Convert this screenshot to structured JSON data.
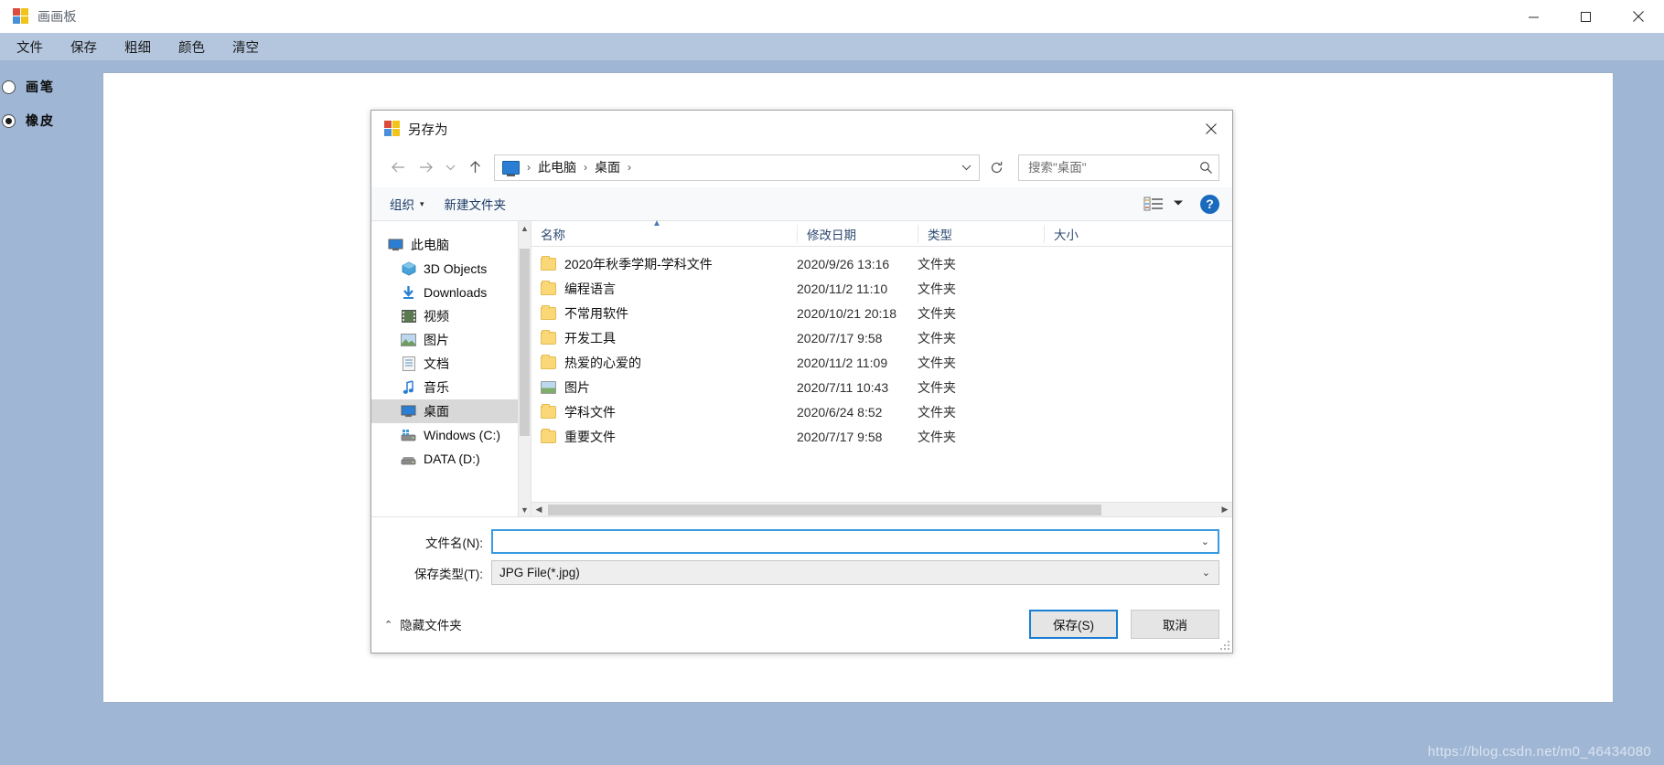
{
  "app": {
    "title": "画画板",
    "icon": "paint-app-icon",
    "window_controls": [
      {
        "name": "minimize",
        "glyph": "minimize-icon"
      },
      {
        "name": "maximize",
        "glyph": "maximize-icon"
      },
      {
        "name": "close",
        "glyph": "close-icon"
      }
    ],
    "menu": [
      {
        "label": "文件"
      },
      {
        "label": "保存"
      },
      {
        "label": "粗细"
      },
      {
        "label": "颜色"
      },
      {
        "label": "清空"
      }
    ],
    "tools": [
      {
        "label": "画笔",
        "selected": false
      },
      {
        "label": "橡皮",
        "selected": true
      }
    ],
    "watermark": "https://blog.csdn.net/m0_46434080"
  },
  "dialog": {
    "title": "另存为",
    "icon": "paint-app-icon",
    "close_label": "×",
    "nav": {
      "back": "back-arrow",
      "forward": "forward-arrow",
      "recent": "recent-chevron",
      "up": "up-arrow",
      "refresh": "refresh-icon"
    },
    "breadcrumb": {
      "root_icon": "this-pc-icon",
      "items": [
        "此电脑",
        "桌面"
      ],
      "separator": "›"
    },
    "search": {
      "placeholder": "搜索\"桌面\"",
      "value": "",
      "icon": "search-icon"
    },
    "toolbar": {
      "organize": "组织",
      "organize_caret": "▾",
      "new_folder": "新建文件夹",
      "view_icon": "view-list-icon",
      "view_caret": "▾",
      "help": "?"
    },
    "nav_pane": {
      "items": [
        {
          "label": "此电脑",
          "icon": "this-pc-icon",
          "level": 0,
          "selected": false
        },
        {
          "label": "3D Objects",
          "icon": "3d-objects-icon",
          "level": 1,
          "selected": false
        },
        {
          "label": "Downloads",
          "icon": "downloads-icon",
          "level": 1,
          "selected": false
        },
        {
          "label": "视频",
          "icon": "videos-icon",
          "level": 1,
          "selected": false
        },
        {
          "label": "图片",
          "icon": "pictures-icon",
          "level": 1,
          "selected": false
        },
        {
          "label": "文档",
          "icon": "documents-icon",
          "level": 1,
          "selected": false
        },
        {
          "label": "音乐",
          "icon": "music-icon",
          "level": 1,
          "selected": false
        },
        {
          "label": "桌面",
          "icon": "desktop-icon",
          "level": 1,
          "selected": true
        },
        {
          "label": "Windows (C:)",
          "icon": "windows-drive-icon",
          "level": 1,
          "selected": false
        },
        {
          "label": "DATA (D:)",
          "icon": "drive-icon",
          "level": 1,
          "selected": false
        }
      ]
    },
    "columns": [
      {
        "key": "name",
        "label": "名称"
      },
      {
        "key": "date",
        "label": "修改日期"
      },
      {
        "key": "type",
        "label": "类型"
      },
      {
        "key": "size",
        "label": "大小"
      }
    ],
    "sort_indicator": "▲",
    "files": [
      {
        "name": "2020年秋季学期-学科文件",
        "date": "2020/9/26 13:16",
        "type": "文件夹",
        "size": "",
        "icon": "folder-icon"
      },
      {
        "name": "编程语言",
        "date": "2020/11/2 11:10",
        "type": "文件夹",
        "size": "",
        "icon": "folder-icon"
      },
      {
        "name": "不常用软件",
        "date": "2020/10/21 20:18",
        "type": "文件夹",
        "size": "",
        "icon": "folder-icon"
      },
      {
        "name": "开发工具",
        "date": "2020/7/17 9:58",
        "type": "文件夹",
        "size": "",
        "icon": "folder-icon"
      },
      {
        "name": "热爱的心爱的",
        "date": "2020/11/2 11:09",
        "type": "文件夹",
        "size": "",
        "icon": "folder-icon"
      },
      {
        "name": "图片",
        "date": "2020/7/11 10:43",
        "type": "文件夹",
        "size": "",
        "icon": "picture-folder-icon"
      },
      {
        "name": "学科文件",
        "date": "2020/6/24 8:52",
        "type": "文件夹",
        "size": "",
        "icon": "folder-icon"
      },
      {
        "name": "重要文件",
        "date": "2020/7/17 9:58",
        "type": "文件夹",
        "size": "",
        "icon": "folder-icon"
      }
    ],
    "form": {
      "filename_label": "文件名(N):",
      "filename_value": "",
      "filetype_label": "保存类型(T):",
      "filetype_value": "JPG File(*.jpg)",
      "caret": "⌄"
    },
    "footer": {
      "hide_folders_caret": "⌃",
      "hide_folders": "隐藏文件夹",
      "save": "保存(S)",
      "cancel": "取消"
    }
  }
}
